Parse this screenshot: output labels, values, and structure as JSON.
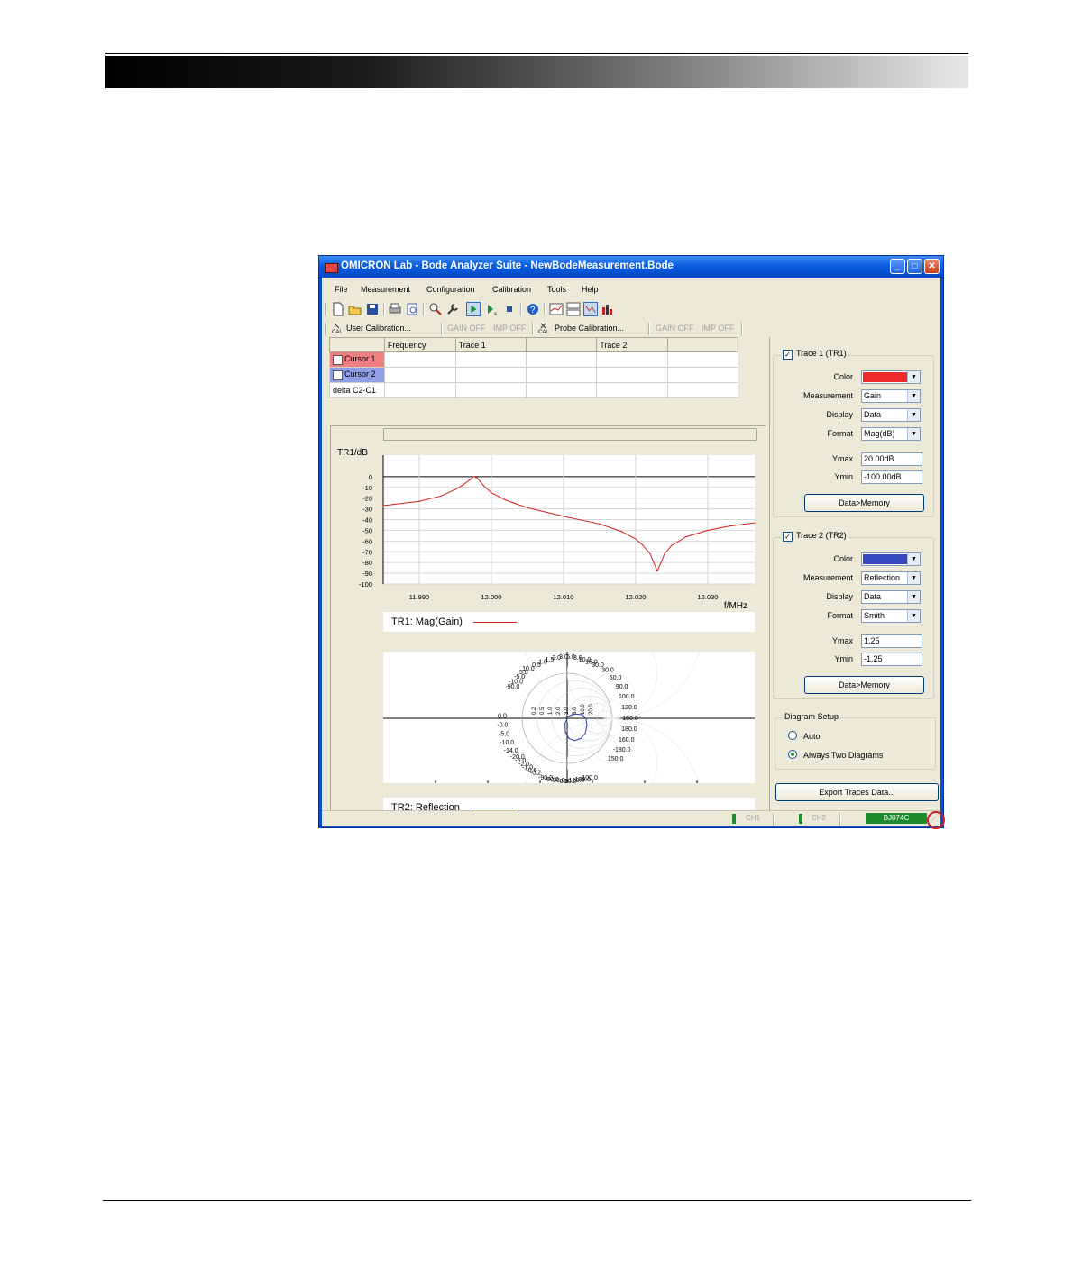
{
  "window": {
    "title": "OMICRON Lab - Bode Analyzer Suite - NewBodeMeasurement.Bode",
    "controls": {
      "minimize": "_",
      "maximize": "□",
      "close": "✕"
    }
  },
  "menu": [
    "File",
    "Measurement",
    "Configuration",
    "Calibration",
    "Tools",
    "Help"
  ],
  "toolbar": {
    "icons": [
      "new-file-icon",
      "open-folder-icon",
      "save-icon",
      "print-icon",
      "print-preview-icon",
      "zoom-icon",
      "wrench-icon",
      "play-icon",
      "single-sweep-icon",
      "stop-icon",
      "help-icon",
      "single-diagram-icon",
      "two-diagrams-icon",
      "chart-view-icon",
      "bar-view-icon"
    ]
  },
  "calibration_bar": {
    "user_calibration": "User Calibration...",
    "gain_off": "GAIN OFF",
    "imp_off": "IMP OFF",
    "probe_calibration": "Probe Calibration...",
    "gain_off_2": "GAIN OFF",
    "imp_off_2": "IMP OFF"
  },
  "cursor_table": {
    "headers": [
      "",
      "Frequency",
      "Trace 1",
      "",
      "Trace 2",
      ""
    ],
    "rows": [
      {
        "label": "Cursor 1",
        "color": "#f08080"
      },
      {
        "label": "Cursor 2",
        "color": "#8fa0e8"
      },
      {
        "label": "delta C2-C1",
        "color": "#ffffff"
      }
    ]
  },
  "chart_data": [
    {
      "type": "line",
      "ylabel": "TR1/dB",
      "xlabel": "f/MHz",
      "ylim": [
        -100,
        20
      ],
      "xlim": [
        11.985,
        12.0365
      ],
      "yticks": [
        0,
        -10,
        -20,
        -30,
        -40,
        -50,
        -60,
        -70,
        -80,
        -90,
        -100
      ],
      "xticks": [
        "11.990",
        "12.000",
        "12.010",
        "12.020",
        "12.030"
      ],
      "grid": true,
      "legend": "TR1: Mag(Gain)",
      "color": "#d02020",
      "series": [
        {
          "name": "TR1: Mag(Gain)",
          "x": [
            11.985,
            11.99,
            11.993,
            11.995,
            11.996,
            11.997,
            11.9975,
            11.998,
            11.9985,
            11.999,
            12.0,
            12.002,
            12.005,
            12.01,
            12.015,
            12.018,
            12.02,
            12.021,
            12.022,
            12.0225,
            12.023,
            12.0235,
            12.024,
            12.025,
            12.027,
            12.03,
            12.033,
            12.0365
          ],
          "y": [
            -27,
            -23,
            -18,
            -12,
            -8,
            -3,
            0,
            -1,
            -5,
            -9,
            -15,
            -22,
            -29,
            -37,
            -44,
            -51,
            -58,
            -64,
            -72,
            -80,
            -88,
            -80,
            -72,
            -64,
            -56,
            -50,
            -46,
            -43
          ]
        }
      ]
    },
    {
      "type": "line",
      "legend": "TR2: Reflection",
      "ylim": [
        -1.25,
        1.25
      ],
      "format": "Smith",
      "color": "#3040a0",
      "series": [
        {
          "name": "TR2: Reflection",
          "x": [
            0.02,
            0.22,
            0.42,
            0.52,
            0.55,
            0.5,
            0.38,
            0.2,
            0.05,
            -0.05,
            -0.06,
            0.02
          ],
          "y": [
            0.05,
            0.12,
            0.1,
            0.0,
            -0.2,
            -0.42,
            -0.56,
            -0.62,
            -0.56,
            -0.38,
            -0.15,
            0.05
          ]
        }
      ]
    }
  ],
  "smith_labels": {
    "top": [
      "0.5",
      "1.0",
      "1.5",
      "2.0",
      "3.0",
      "5.0",
      "8.0",
      "10.0",
      "15.0",
      "30.0"
    ],
    "upper_left": [
      "-90.0",
      "-10.0",
      "-5.0",
      "5.0",
      "10.0"
    ],
    "left": [
      "0.0",
      "-0.0",
      "-5.0",
      "-10.0",
      "-14.0"
    ],
    "right": [
      "30.0",
      "60.0",
      "90.0",
      "100.0",
      "120.0",
      "150.0",
      "180.0",
      "160.0",
      "-180.0",
      "150.0"
    ],
    "row": [
      "0.2",
      "0.5",
      "1.0",
      "2.0",
      "3.0",
      "5.0",
      "10.0",
      "20.0"
    ],
    "bottom": [
      "-90.0",
      "-60.0",
      "-30.0",
      "0.0",
      "30.0",
      "120.0",
      "180.0",
      "-100.0"
    ],
    "bottom_left": [
      "-20.0",
      "-5.0",
      "-2.0",
      "-1.0",
      "-0.5",
      "-0.2"
    ]
  },
  "trace1": {
    "title": "Trace 1 (TR1)",
    "checked": true,
    "color": "#ee2a2a",
    "labels": {
      "color": "Color",
      "measurement": "Measurement",
      "display": "Display",
      "format": "Format",
      "ymax": "Ymax",
      "ymin": "Ymin"
    },
    "measurement": "Gain",
    "display": "Data",
    "format": "Mag(dB)",
    "ymax": "20.00dB",
    "ymin": "-100.00dB",
    "button": "Data>Memory"
  },
  "trace2": {
    "title": "Trace 2 (TR2)",
    "checked": true,
    "color": "#3548c0",
    "labels": {
      "color": "Color",
      "measurement": "Measurement",
      "display": "Display",
      "format": "Format",
      "ymax": "Ymax",
      "ymin": "Ymin"
    },
    "measurement": "Reflection",
    "display": "Data",
    "format": "Smith",
    "ymax": "1.25",
    "ymin": "-1.25",
    "button": "Data>Memory"
  },
  "diagram_setup": {
    "title": "Diagram Setup",
    "options": [
      "Auto",
      "Always Two Diagrams"
    ],
    "selected": "Always Two Diagrams"
  },
  "export_button": "Export Traces Data...",
  "status": {
    "ch1": "CH1",
    "ch2": "CH2",
    "device": "BJ074C"
  }
}
